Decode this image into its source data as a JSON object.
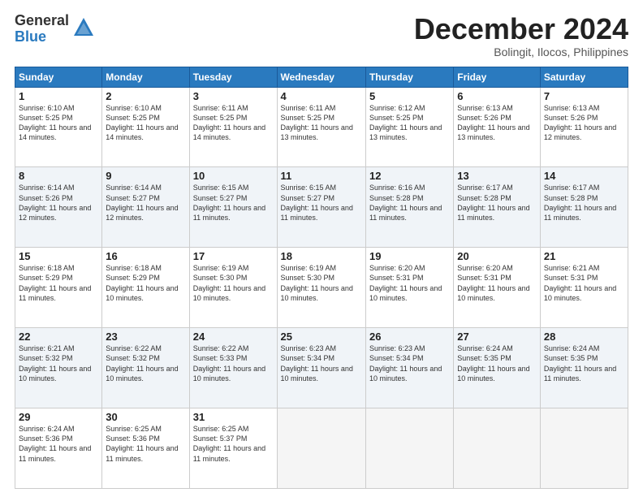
{
  "logo": {
    "general": "General",
    "blue": "Blue"
  },
  "title": "December 2024",
  "location": "Bolingit, Ilocos, Philippines",
  "days_header": [
    "Sunday",
    "Monday",
    "Tuesday",
    "Wednesday",
    "Thursday",
    "Friday",
    "Saturday"
  ],
  "weeks": [
    [
      {
        "day": "1",
        "sunrise": "6:10 AM",
        "sunset": "5:25 PM",
        "daylight": "11 hours and 14 minutes."
      },
      {
        "day": "2",
        "sunrise": "6:10 AM",
        "sunset": "5:25 PM",
        "daylight": "11 hours and 14 minutes."
      },
      {
        "day": "3",
        "sunrise": "6:11 AM",
        "sunset": "5:25 PM",
        "daylight": "11 hours and 14 minutes."
      },
      {
        "day": "4",
        "sunrise": "6:11 AM",
        "sunset": "5:25 PM",
        "daylight": "11 hours and 13 minutes."
      },
      {
        "day": "5",
        "sunrise": "6:12 AM",
        "sunset": "5:25 PM",
        "daylight": "11 hours and 13 minutes."
      },
      {
        "day": "6",
        "sunrise": "6:13 AM",
        "sunset": "5:26 PM",
        "daylight": "11 hours and 13 minutes."
      },
      {
        "day": "7",
        "sunrise": "6:13 AM",
        "sunset": "5:26 PM",
        "daylight": "11 hours and 12 minutes."
      }
    ],
    [
      {
        "day": "8",
        "sunrise": "6:14 AM",
        "sunset": "5:26 PM",
        "daylight": "11 hours and 12 minutes."
      },
      {
        "day": "9",
        "sunrise": "6:14 AM",
        "sunset": "5:27 PM",
        "daylight": "11 hours and 12 minutes."
      },
      {
        "day": "10",
        "sunrise": "6:15 AM",
        "sunset": "5:27 PM",
        "daylight": "11 hours and 11 minutes."
      },
      {
        "day": "11",
        "sunrise": "6:15 AM",
        "sunset": "5:27 PM",
        "daylight": "11 hours and 11 minutes."
      },
      {
        "day": "12",
        "sunrise": "6:16 AM",
        "sunset": "5:28 PM",
        "daylight": "11 hours and 11 minutes."
      },
      {
        "day": "13",
        "sunrise": "6:17 AM",
        "sunset": "5:28 PM",
        "daylight": "11 hours and 11 minutes."
      },
      {
        "day": "14",
        "sunrise": "6:17 AM",
        "sunset": "5:28 PM",
        "daylight": "11 hours and 11 minutes."
      }
    ],
    [
      {
        "day": "15",
        "sunrise": "6:18 AM",
        "sunset": "5:29 PM",
        "daylight": "11 hours and 11 minutes."
      },
      {
        "day": "16",
        "sunrise": "6:18 AM",
        "sunset": "5:29 PM",
        "daylight": "11 hours and 10 minutes."
      },
      {
        "day": "17",
        "sunrise": "6:19 AM",
        "sunset": "5:30 PM",
        "daylight": "11 hours and 10 minutes."
      },
      {
        "day": "18",
        "sunrise": "6:19 AM",
        "sunset": "5:30 PM",
        "daylight": "11 hours and 10 minutes."
      },
      {
        "day": "19",
        "sunrise": "6:20 AM",
        "sunset": "5:31 PM",
        "daylight": "11 hours and 10 minutes."
      },
      {
        "day": "20",
        "sunrise": "6:20 AM",
        "sunset": "5:31 PM",
        "daylight": "11 hours and 10 minutes."
      },
      {
        "day": "21",
        "sunrise": "6:21 AM",
        "sunset": "5:31 PM",
        "daylight": "11 hours and 10 minutes."
      }
    ],
    [
      {
        "day": "22",
        "sunrise": "6:21 AM",
        "sunset": "5:32 PM",
        "daylight": "11 hours and 10 minutes."
      },
      {
        "day": "23",
        "sunrise": "6:22 AM",
        "sunset": "5:32 PM",
        "daylight": "11 hours and 10 minutes."
      },
      {
        "day": "24",
        "sunrise": "6:22 AM",
        "sunset": "5:33 PM",
        "daylight": "11 hours and 10 minutes."
      },
      {
        "day": "25",
        "sunrise": "6:23 AM",
        "sunset": "5:34 PM",
        "daylight": "11 hours and 10 minutes."
      },
      {
        "day": "26",
        "sunrise": "6:23 AM",
        "sunset": "5:34 PM",
        "daylight": "11 hours and 10 minutes."
      },
      {
        "day": "27",
        "sunrise": "6:24 AM",
        "sunset": "5:35 PM",
        "daylight": "11 hours and 10 minutes."
      },
      {
        "day": "28",
        "sunrise": "6:24 AM",
        "sunset": "5:35 PM",
        "daylight": "11 hours and 11 minutes."
      }
    ],
    [
      {
        "day": "29",
        "sunrise": "6:24 AM",
        "sunset": "5:36 PM",
        "daylight": "11 hours and 11 minutes."
      },
      {
        "day": "30",
        "sunrise": "6:25 AM",
        "sunset": "5:36 PM",
        "daylight": "11 hours and 11 minutes."
      },
      {
        "day": "31",
        "sunrise": "6:25 AM",
        "sunset": "5:37 PM",
        "daylight": "11 hours and 11 minutes."
      },
      null,
      null,
      null,
      null
    ]
  ]
}
